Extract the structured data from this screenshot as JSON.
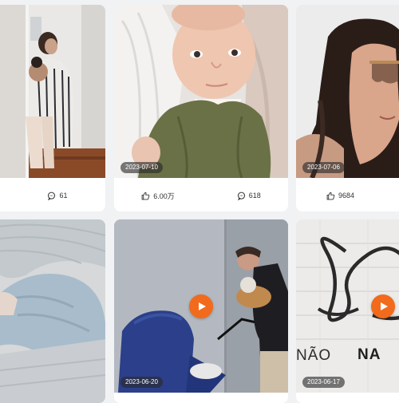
{
  "theme": {
    "background": "#f1f2f4",
    "card": "#ffffff",
    "accent": "#f26a1b",
    "badge_bg": "#282828"
  },
  "icons": {
    "like": "thumbs-up-icon",
    "comment": "speech-bubble-icon",
    "play": "play-icon"
  },
  "cards": [
    {
      "date": "",
      "likes": "",
      "comments": "61",
      "video": false
    },
    {
      "date": "2023-07-10",
      "likes": "6.00万",
      "comments": "618",
      "video": false
    },
    {
      "date": "2023-07-06",
      "likes": "9684",
      "comments": "",
      "video": false
    },
    {
      "date": "",
      "video": false
    },
    {
      "date": "2023-06-20",
      "video": true
    },
    {
      "date": "2023-06-17",
      "video": true
    }
  ],
  "sign_text": {
    "line1": "NÃO",
    "line2": "NA",
    "script": "D"
  }
}
